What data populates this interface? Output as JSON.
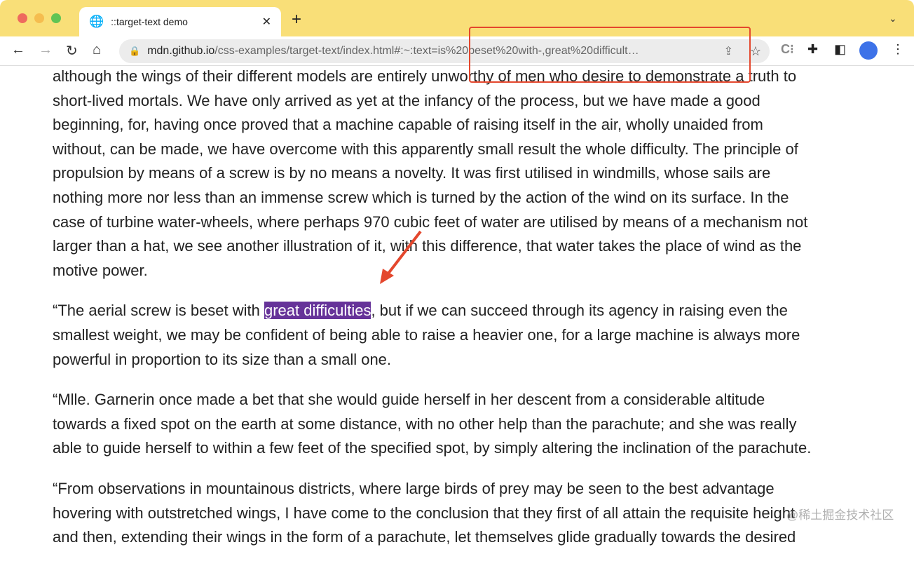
{
  "browser": {
    "tab_title": "::target-text demo",
    "url_host": "mdn.github.io",
    "url_path": "/css-examples/target-text/index.html#:~:text=is%20beset%20with-,great%20difficult…"
  },
  "paragraphs": [
    {
      "lines": [
        "although the wings of their different models are entirely unworthy of men who desire to demonstrate a truth to",
        "short-lived mortals. We have only arrived as yet at the infancy of the process, but we have made a good",
        "beginning, for, having once proved that a machine capable of raising itself in the air, wholly unaided from",
        "without, can be made, we have overcome with this apparently small result the whole difficulty. The principle of",
        "propulsion by means of a screw is by no means a novelty. It was first utilised in windmills, whose sails are",
        "nothing more nor less than an immense screw which is turned by the action of the wind on its surface. In the",
        "case of turbine water-wheels, where perhaps 970 cubic feet of water are utilised by means of a mechanism not",
        "larger than a hat, we see another illustration of it, with this difference, that water takes the place of wind as the",
        "motive power."
      ]
    },
    {
      "before": "“The aerial screw is beset with ",
      "highlight": "great difficulties",
      "after": ", but if we can succeed through its agency in raising even the",
      "lines": [
        "smallest weight, we may be confident of being able to raise a heavier one, for a large machine is always more",
        "powerful in proportion to its size than a small one."
      ]
    },
    {
      "lines": [
        "“Mlle. Garnerin once made a bet that she would guide herself in her descent from a considerable altitude",
        "towards a fixed spot on the earth at some distance, with no other help than the parachute; and she was really",
        "able to guide herself to within a few feet of the specified spot, by simply altering the inclination of the parachute."
      ]
    },
    {
      "lines": [
        "“From observations in mountainous districts, where large birds of prey may be seen to the best advantage",
        "hovering with outstretched wings, I have come to the conclusion that they first of all attain the requisite height",
        "and then, extending their wings in the form of a parachute, let themselves glide gradually towards the desired"
      ]
    }
  ],
  "watermark": "@稀土掘金技术社区",
  "colors": {
    "highlight": "#663399",
    "annotation": "#e4472d",
    "tabbar": "#f9df78"
  }
}
